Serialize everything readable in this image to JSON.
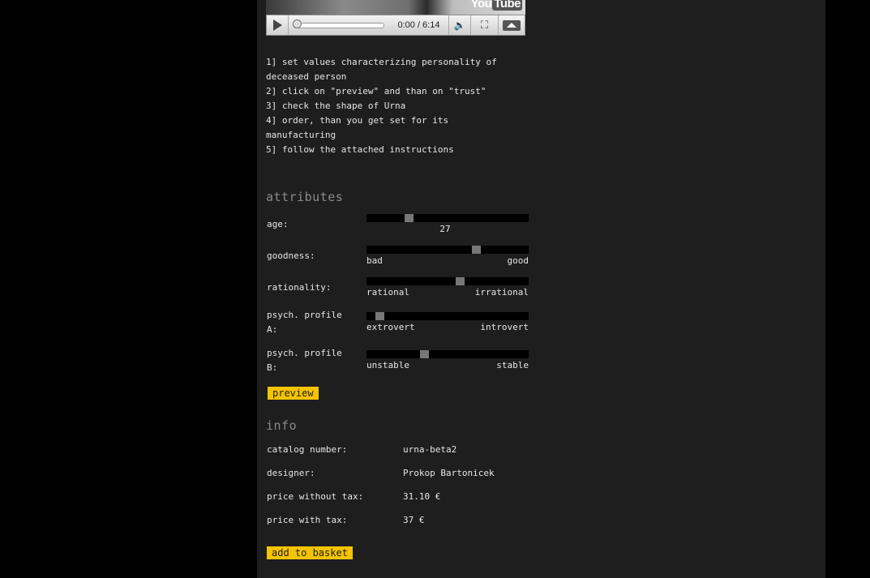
{
  "video": {
    "logo_you": "You",
    "logo_tube": "Tube",
    "time": "0:00 / 6:14",
    "progress": 0
  },
  "instructions": [
    "1] set values characterizing personality of",
    "deceased person",
    "2] click on \"preview\" and than on \"trust\"",
    "3] check the shape of Urna",
    "4] order, than you get set for its",
    "manufacturing",
    "5] follow the attached instructions"
  ],
  "attributes": {
    "title": "attributes",
    "age": {
      "label": "age:",
      "value": "27",
      "level": 0.25
    },
    "goodness": {
      "label": "goodness:",
      "min": "bad",
      "max": "good",
      "level": 0.69
    },
    "rationality": {
      "label": "rationality:",
      "min": "rational",
      "max": "irrational",
      "level": 0.58
    },
    "psych_a": {
      "label_1": "psych. profile",
      "label_2": "A:",
      "min": "extrovert",
      "max": "introvert",
      "level": 0.06
    },
    "psych_b": {
      "label_1": "psych. profile",
      "label_2": "B:",
      "min": "unstable",
      "max": "stable",
      "level": 0.35
    },
    "preview_label": "preview"
  },
  "info": {
    "title": "info",
    "catalog_number": {
      "label": "catalog number:",
      "value": "urna-beta2"
    },
    "designer": {
      "label": "designer:",
      "value": "Prokop Bartonicek"
    },
    "price_without_tax": {
      "label": "price without tax:",
      "value": "31.10 €"
    },
    "price_with_tax": {
      "label": "price with tax:",
      "value": "37 €"
    },
    "basket_label": "add to basket"
  },
  "colors": {
    "background": "#000000",
    "panel": "#1e1e1e",
    "accent": "#f5c400",
    "text": "#e6e6e6",
    "heading": "#8a8a8a"
  }
}
